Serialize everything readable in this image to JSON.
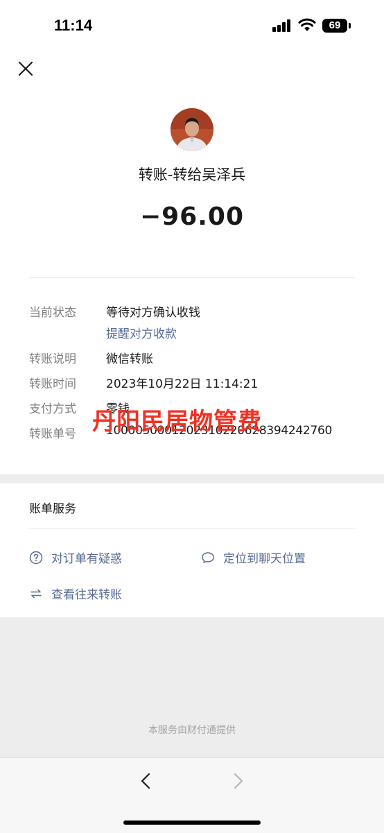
{
  "status_bar": {
    "time": "11:14",
    "battery": "69"
  },
  "header": {
    "close_icon": "close-icon"
  },
  "transfer": {
    "title": "转账-转给吴泽兵",
    "amount": "−96.00"
  },
  "details": {
    "status_label": "当前状态",
    "status_value": "等待对方确认收钱",
    "remind_link": "提醒对方收款",
    "desc_label": "转账说明",
    "desc_value": "微信转账",
    "time_label": "转账时间",
    "time_value": "2023年10月22日 11:14:21",
    "method_label": "支付方式",
    "method_value": "零钱",
    "order_label": "转账单号",
    "order_value": "1000050001202310220628394242760"
  },
  "watermark": "丹阳民居物管费",
  "bill_service": {
    "title": "账单服务",
    "question": "对订单有疑惑",
    "locate": "定位到聊天位置",
    "history": "查看往来转账"
  },
  "footer": "本服务由财付通提供",
  "colors": {
    "link": "#576b95",
    "watermark": "#ee3224",
    "background": "#ededed"
  }
}
